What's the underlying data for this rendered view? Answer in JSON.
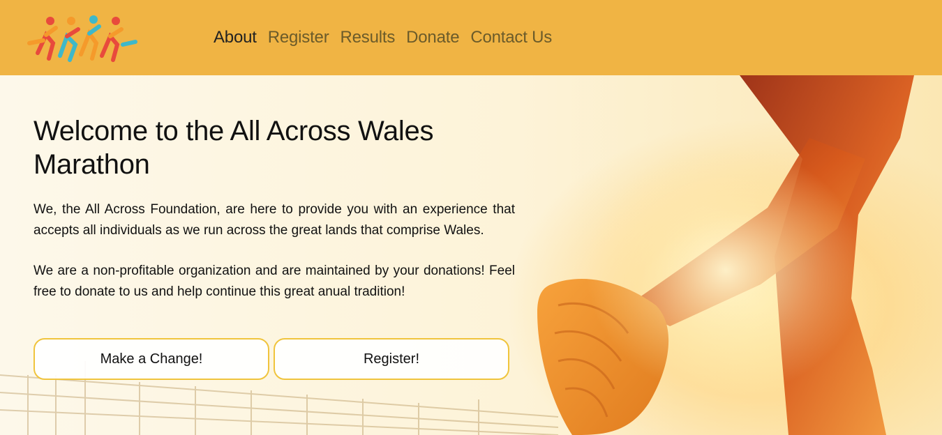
{
  "header": {
    "logo_icon": "runners-logo-icon",
    "nav": [
      {
        "label": "About",
        "active": true
      },
      {
        "label": "Register",
        "active": false
      },
      {
        "label": "Results",
        "active": false
      },
      {
        "label": "Donate",
        "active": false
      },
      {
        "label": "Contact Us",
        "active": false
      }
    ]
  },
  "hero": {
    "title": "Welcome to the All Across Wales Marathon",
    "paragraphs": [
      "We, the All Across Foundation, are here to provide you with an experience that accepts all individuals as we run across the great lands that comprise Wales.",
      "We are a non-profitable organization and are maintained by your donations! Feel free to donate to us and help continue this great anual tradition!"
    ],
    "buttons": {
      "change": "Make a Change!",
      "register": "Register!"
    },
    "image_icon": "runner-legs-photo"
  },
  "colors": {
    "header_bg": "#f0b444",
    "button_border": "#f0c43c",
    "nav_inactive": "#6b5b2a",
    "nav_active": "#222222"
  }
}
